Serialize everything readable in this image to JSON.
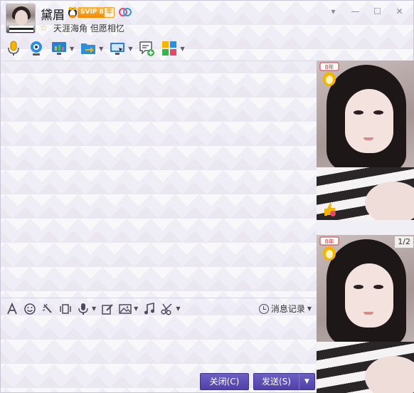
{
  "header": {
    "nickname": "黛眉",
    "svip_badge": "SVIP 8",
    "year_badge": "年",
    "signature": "天涯海角 但愿相忆",
    "window_controls": [
      "▾",
      "—",
      "☐",
      "✕"
    ]
  },
  "main_toolbar": {
    "items": [
      {
        "icon": "microphone-icon",
        "has_arrow": false
      },
      {
        "icon": "webcam-icon",
        "has_arrow": false
      },
      {
        "icon": "screen-share-icon",
        "has_arrow": true
      },
      {
        "icon": "file-transfer-icon",
        "has_arrow": true
      },
      {
        "icon": "remote-desktop-icon",
        "has_arrow": true
      },
      {
        "icon": "new-chat-icon",
        "has_arrow": false
      },
      {
        "icon": "apps-icon",
        "has_arrow": true
      }
    ]
  },
  "input_toolbar": {
    "items": [
      "font-icon",
      "emoji-icon",
      "shake-icon",
      "screenshot-frame-icon",
      "voice-message-icon",
      "edit-icon",
      "image-icon",
      "music-icon",
      "scissors-icon"
    ],
    "history_label": "消息记录"
  },
  "buttons": {
    "close_label": "关闭(C)",
    "send_label": "发送(S)",
    "send_dropdown": "▼"
  },
  "photos": {
    "counter": "1/2",
    "top_badge": "8年"
  },
  "colors": {
    "accent": "#5546b0",
    "svip": "#f28a00",
    "background": "#efedf5"
  }
}
